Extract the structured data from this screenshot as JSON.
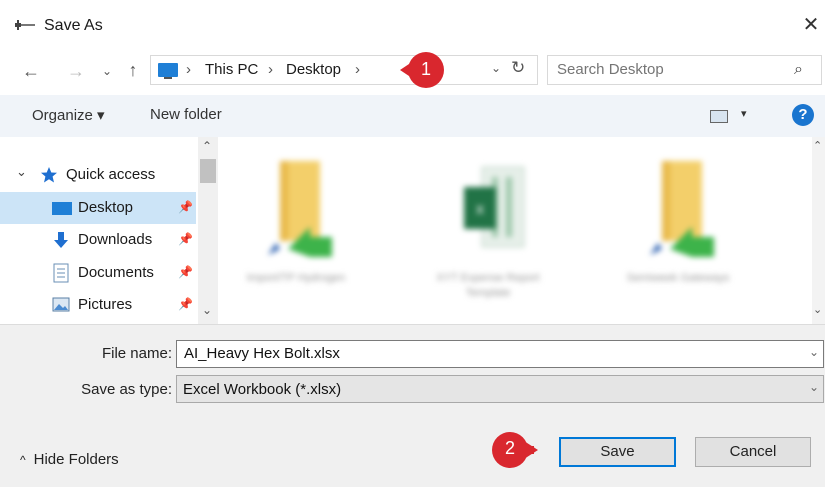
{
  "window": {
    "title": "Save As",
    "close_glyph": "✕"
  },
  "nav": {
    "back_glyph": "←",
    "forward_glyph": "→",
    "recent_glyph": "⌄",
    "up_glyph": "↑",
    "breadcrumbs": [
      "This PC",
      "Desktop"
    ],
    "separator": "›",
    "refresh_glyph": "↻",
    "dropdown_glyph": "⌄"
  },
  "search": {
    "placeholder": "Search Desktop",
    "icon_glyph": "⌕"
  },
  "callouts": {
    "first": "1",
    "second": "2",
    "color": "#d9272e"
  },
  "toolbar": {
    "organize_label": "Organize ▾",
    "new_folder_label": "New folder",
    "help_glyph": "?",
    "view_dd_glyph": "▾"
  },
  "sidebar": {
    "group": {
      "label": "Quick access",
      "chevron": "⌄"
    },
    "items": [
      {
        "label": "Desktop",
        "selected": true
      },
      {
        "label": "Downloads"
      },
      {
        "label": "Documents"
      },
      {
        "label": "Pictures"
      }
    ],
    "pin_glyph": "📌"
  },
  "scroll": {
    "up": "⌃",
    "down": "⌄"
  },
  "files": [
    {
      "label": "Import/TP Hydrogen",
      "icon": "folder-shortcut-icon"
    },
    {
      "label": "XYT Expense Report Template",
      "icon": "excel-file-icon"
    },
    {
      "label": "Semiweek Gateways",
      "icon": "folder-shortcut-icon"
    }
  ],
  "form": {
    "file_name_label": "File name:",
    "file_name_value": "AI_Heavy Hex Bolt.xlsx",
    "save_type_label": "Save as type:",
    "save_type_value": "Excel Workbook (*.xlsx)",
    "dropdown_glyph": "⌄"
  },
  "footer": {
    "hide_folders_label": "Hide Folders",
    "hide_glyph": "^",
    "save_label": "Save",
    "cancel_label": "Cancel"
  },
  "colors": {
    "accent": "#0078d7",
    "toolbar_bg": "#f0f4f9",
    "selected_bg": "#cce4f7",
    "excel_green": "#217346",
    "folder_yellow": "#f3cf6a"
  }
}
